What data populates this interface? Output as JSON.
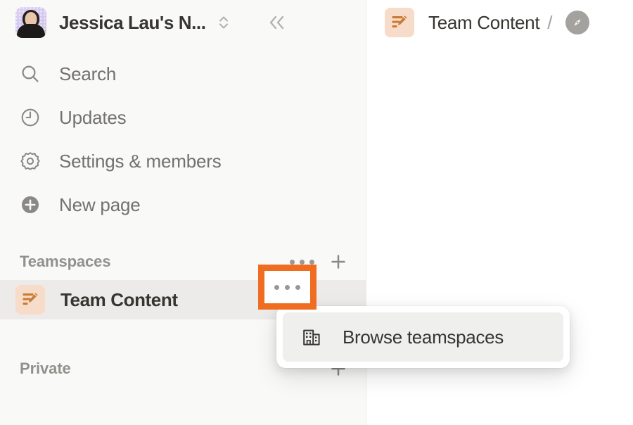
{
  "workspace": {
    "avatar_name": "workspace-avatar",
    "title": "Jessica Lau's N...",
    "switcher_icon": "chevron-up-down-icon",
    "collapse_icon": "double-chevron-left-icon"
  },
  "sidebar": {
    "nav_items": [
      {
        "icon": "search-icon",
        "label": "Search"
      },
      {
        "icon": "clock-icon",
        "label": "Updates"
      },
      {
        "icon": "gear-icon",
        "label": "Settings & members"
      },
      {
        "icon": "plus-circle-icon",
        "label": "New page"
      }
    ],
    "sections": [
      {
        "title": "Teamspaces",
        "more_icon": "ellipsis-icon",
        "add_icon": "plus-icon",
        "pages": [
          {
            "icon": "team-content-icon",
            "label": "Team Content"
          }
        ]
      },
      {
        "title": "Private",
        "add_icon": "plus-icon",
        "pages": []
      }
    ]
  },
  "header": {
    "breadcrumb_icon": "team-content-icon",
    "breadcrumb_label": "Team Content",
    "separator": "/",
    "compass_icon": "compass-icon"
  },
  "dropdown": {
    "items": [
      {
        "icon": "building-icon",
        "label": "Browse teamspaces"
      }
    ]
  },
  "highlight": {
    "name": "annotation-highlight-box",
    "color": "#ef6c21",
    "target": "teamspaces-more-button"
  },
  "colors": {
    "sidebar_bg": "#f9f9f8",
    "main_bg": "#ffffff",
    "text_primary": "#373530",
    "text_secondary": "#73716c",
    "text_muted": "#91918c",
    "accent_orange": "#ef6c21",
    "page_icon_bg": "#f7ddc9",
    "page_icon_fg": "#cb7b37",
    "row_hover": "#ecebea"
  }
}
